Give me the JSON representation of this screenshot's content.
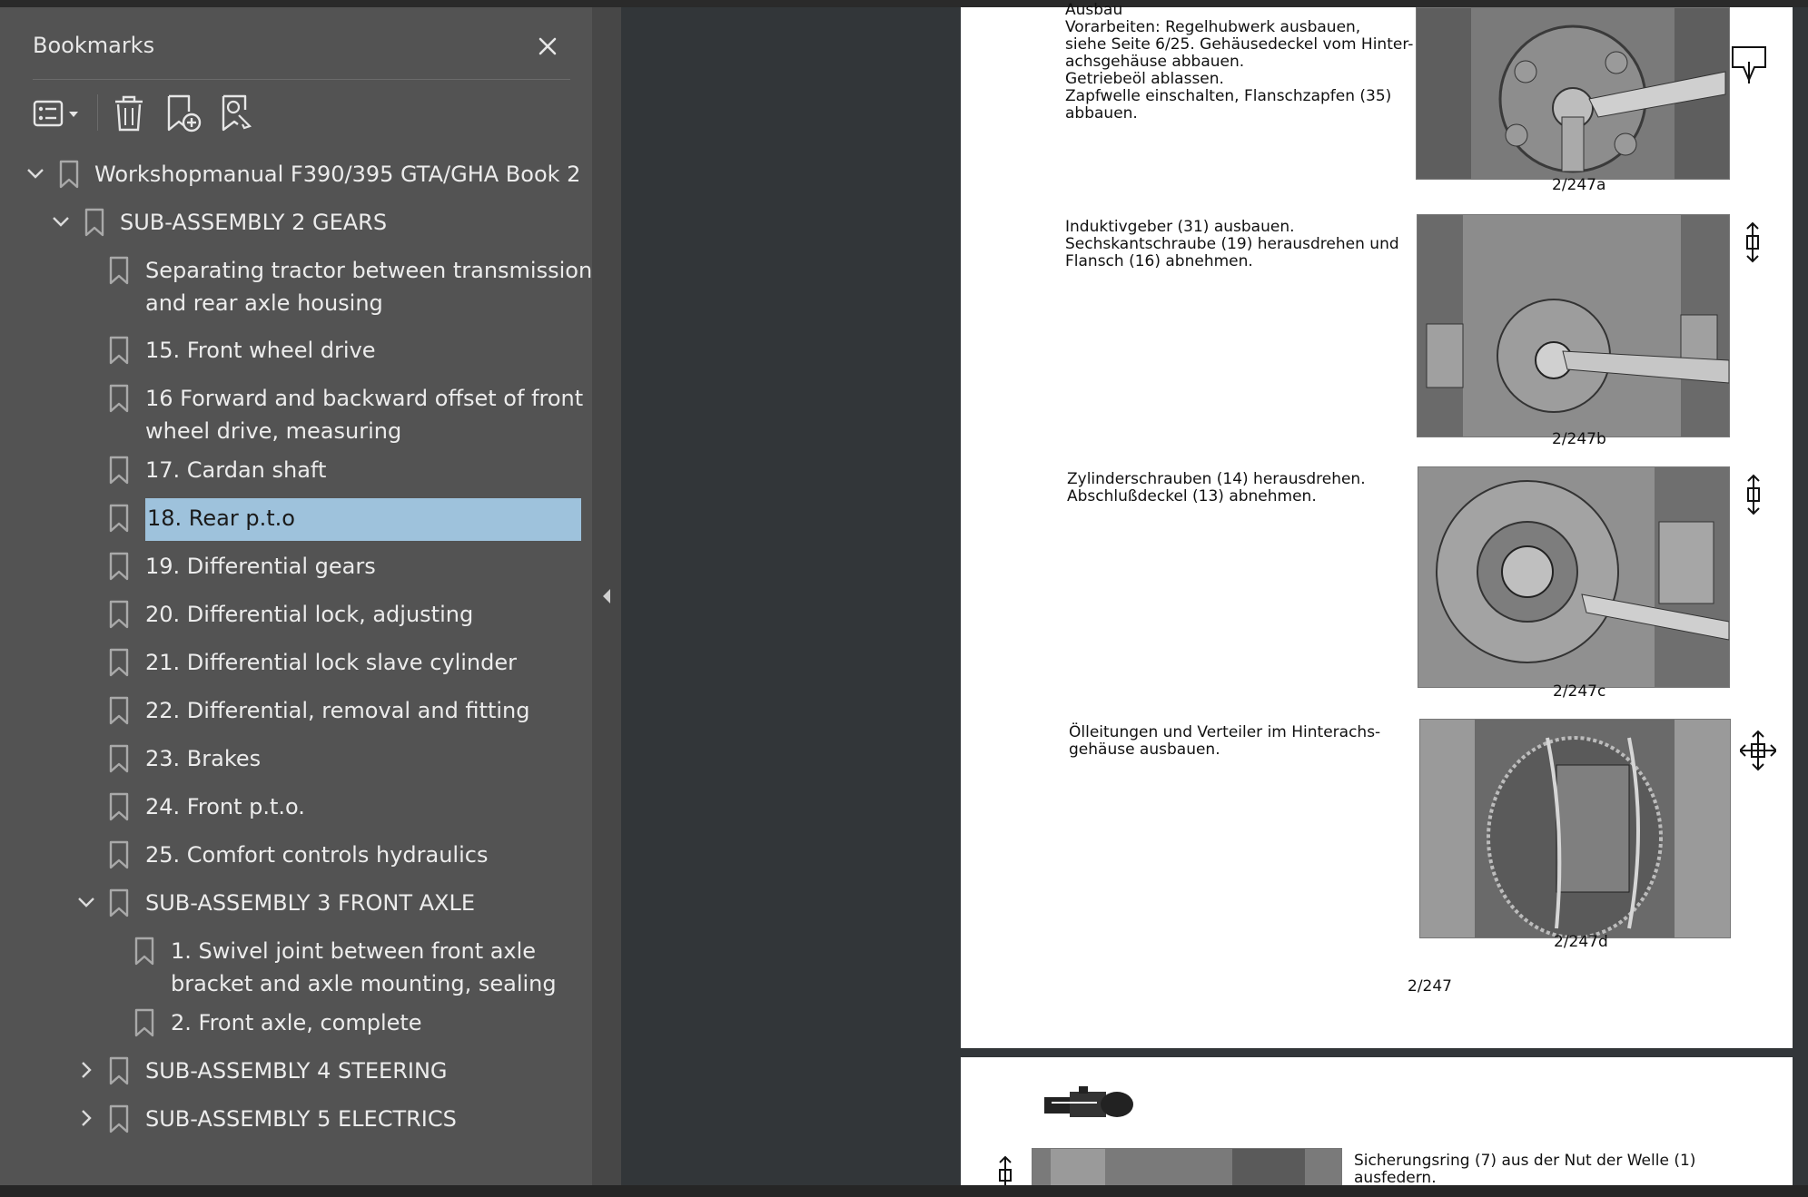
{
  "sidebar": {
    "title": "Bookmarks",
    "close_icon": "close-icon",
    "toolbar": [
      {
        "name": "options-menu-button",
        "icon": "list-options-icon"
      },
      {
        "name": "delete-bookmark-button",
        "icon": "trash-icon"
      },
      {
        "name": "add-bookmark-button",
        "icon": "bookmark-add-icon"
      },
      {
        "name": "find-bookmark-button",
        "icon": "bookmark-search-icon"
      }
    ],
    "items": [
      {
        "label": "Workshopmanual F390/395 GTA/GHA Book 2",
        "expanded": true
      },
      {
        "label": "SUB-ASSEMBLY 2 GEARS",
        "expanded": true
      },
      {
        "label_line1": "Separating tractor between transmission",
        "label_line2": "and rear axle housing"
      },
      {
        "label": "15. Front wheel drive"
      },
      {
        "label_line1": "16 Forward and backward offset of front",
        "label_line2": "wheel drive, measuring"
      },
      {
        "label": "17. Cardan shaft"
      },
      {
        "label": "18. Rear p.t.o",
        "selected": true
      },
      {
        "label": "19. Differential gears"
      },
      {
        "label": "20. Differential lock, adjusting"
      },
      {
        "label": "21. Differential lock slave cylinder"
      },
      {
        "label": "22. Differential, removal and fitting"
      },
      {
        "label": "23. Brakes"
      },
      {
        "label": "24. Front p.t.o."
      },
      {
        "label": "25. Comfort controls hydraulics"
      },
      {
        "label": "SUB-ASSEMBLY 3 FRONT AXLE",
        "expanded": true
      },
      {
        "label": "1. Swivel joint between front axle",
        "label_line2": "bracket and axle mounting, sealing"
      },
      {
        "label": "2. Front axle, complete"
      },
      {
        "label": "SUB-ASSEMBLY 4 STEERING",
        "expanded": false
      },
      {
        "label": "SUB-ASSEMBLY 5 ELECTRICS",
        "expanded": false
      }
    ],
    "selected_color": "#9ec2dc"
  },
  "document": {
    "page1": {
      "blocks": [
        {
          "text": "Ausbau\nVorarbeiten: Regelhubwerk ausbauen,\nsiehe Seite 6/25. Gehäusedeckel vom Hinter-\nachsgehäuse abbauen.\nGetriebeöl ablassen.\nZapfwelle einschalten, Flanschzapfen (35)\nabbauen.",
          "caption": "2/247a"
        },
        {
          "text": "Induktivgeber (31) ausbauen.\nSechskantschraube (19) herausdrehen und\nFlansch (16) abnehmen.",
          "caption": "2/247b"
        },
        {
          "text": "Zylinderschrauben (14) herausdrehen.\nAbschlußdeckel (13) abnehmen.",
          "caption": "2/247c"
        },
        {
          "text": "Ölleitungen und Verteiler im Hinterachs-\ngehäuse ausbauen.",
          "caption": "2/247d"
        }
      ],
      "page_number": "2/247"
    },
    "page2": {
      "text": "Sicherungsring (7) aus der Nut der Welle (1)\nausfedern."
    }
  }
}
